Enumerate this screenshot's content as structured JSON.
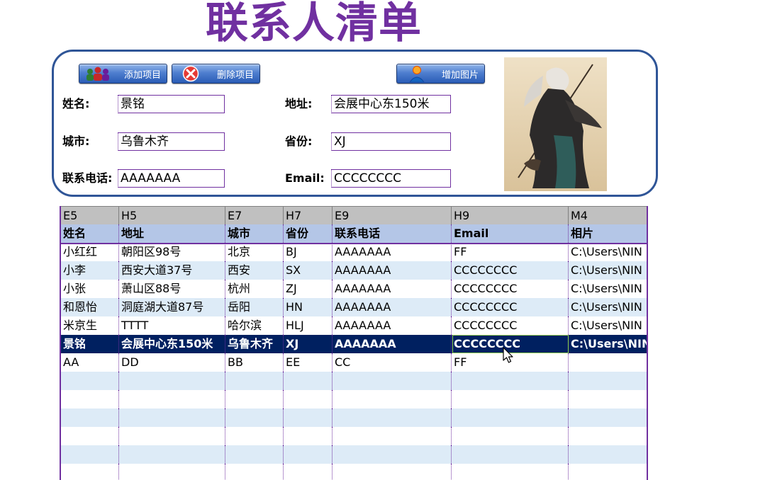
{
  "title": "联系人清单",
  "toolbar": {
    "add_label": "添加项目",
    "delete_label": "删除项目",
    "image_label": "增加图片"
  },
  "form": {
    "name_label": "姓名:",
    "name_value": "景铭",
    "address_label": "地址:",
    "address_value": "会展中心东150米",
    "city_label": "城市:",
    "city_value": "乌鲁木齐",
    "province_label": "省份:",
    "province_value": "XJ",
    "phone_label": "联系电话:",
    "phone_value": "AAAAAAA",
    "email_label": "Email:",
    "email_value": "CCCCCCCC"
  },
  "table": {
    "refs": [
      "E5",
      "H5",
      "E7",
      "H7",
      "E9",
      "H9",
      "M4"
    ],
    "headers": [
      "姓名",
      "地址",
      "城市",
      "省份",
      "联系电话",
      "Email",
      "相片"
    ],
    "rows": [
      [
        "小红红",
        "朝阳区98号",
        "北京",
        "BJ",
        "AAAAAAA",
        "FF",
        "C:\\Users\\NIN"
      ],
      [
        "小李",
        "西安大道37号",
        "西安",
        "SX",
        "AAAAAAA",
        "CCCCCCCC",
        "C:\\Users\\NIN"
      ],
      [
        "小张",
        "萧山区88号",
        "杭州",
        "ZJ",
        "AAAAAAA",
        "CCCCCCCC",
        "C:\\Users\\NIN"
      ],
      [
        "和恩怡",
        "洞庭湖大道87号",
        "岳阳",
        "HN",
        "AAAAAAA",
        "CCCCCCCC",
        "C:\\Users\\NIN"
      ],
      [
        "米京生",
        "TTTT",
        "哈尔滨",
        "HLJ",
        "AAAAAAA",
        "CCCCCCCC",
        "C:\\Users\\NIN"
      ],
      [
        "景铭",
        "会展中心东150米",
        "乌鲁木齐",
        "XJ",
        "AAAAAAA",
        "CCCCCCCC",
        "C:\\Users\\NIN"
      ],
      [
        "AA",
        "DD",
        "BB",
        "EE",
        "CC",
        "FF",
        ""
      ],
      [
        "",
        "",
        "",
        "",
        "",
        "",
        ""
      ],
      [
        "",
        "",
        "",
        "",
        "",
        "",
        ""
      ],
      [
        "",
        "",
        "",
        "",
        "",
        "",
        ""
      ],
      [
        "",
        "",
        "",
        "",
        "",
        "",
        ""
      ],
      [
        "",
        "",
        "",
        "",
        "",
        "",
        ""
      ],
      [
        "",
        "",
        "",
        "",
        "",
        "",
        ""
      ]
    ],
    "selected_row": 5
  },
  "colors": {
    "title": "#7030a0",
    "panel_border": "#2f5597",
    "header_fill": "#b4c6e7",
    "alt_fill": "#ddebf7",
    "selected_fill": "#002060"
  },
  "icons": {
    "add": "people-add-icon",
    "delete": "red-x-icon",
    "image": "person-pin-icon",
    "cursor": "pointer-cursor-icon"
  }
}
